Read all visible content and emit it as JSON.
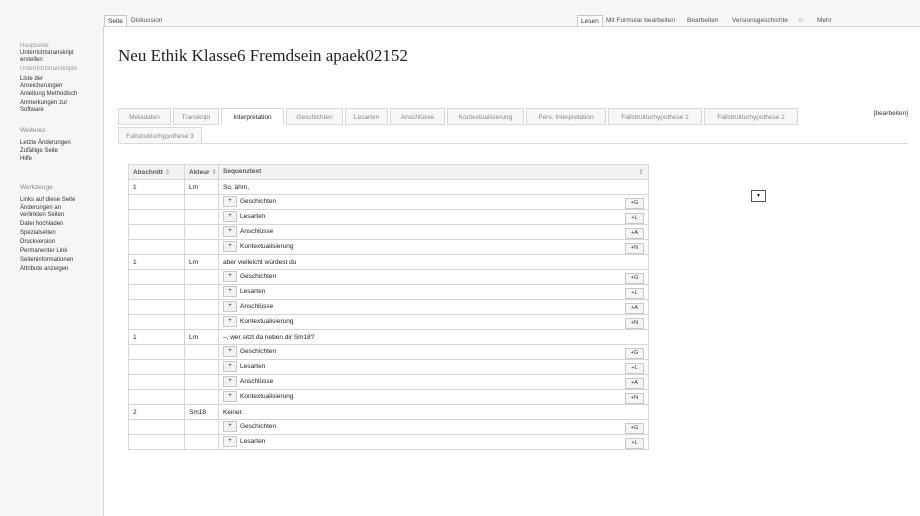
{
  "top_tabs": {
    "seite": "Seite",
    "diskussion": "Diskussion",
    "lesen": "Lesen",
    "mit_formular": "Mit Formular bearbeiten",
    "bearbeiten": "Bearbeiten",
    "versionsgeschichte": "Versionsgeschichte",
    "star_icon": "☆",
    "mehr": "Mehr"
  },
  "sidebar": {
    "nav": [
      {
        "label": "Hauptseite",
        "dim": true
      },
      {
        "label": "Unterrichtstranskript",
        "dim": false
      },
      {
        "label": "erstellen",
        "dim": false
      },
      {
        "label": "Unterrichtstranskripte",
        "dim": true
      },
      {
        "label": "Liste der",
        "dim": false
      },
      {
        "label": "Anreicherungen",
        "dim": false
      },
      {
        "label": "Anleitung Methodisch",
        "dim": false
      },
      {
        "label": "Anmerkungen zur",
        "dim": false
      },
      {
        "label": "Software",
        "dim": false
      }
    ],
    "weiteres_heading": "Weiteres",
    "weiteres": [
      "Letzte Änderungen",
      "Zufällige Seite",
      "Hilfe"
    ],
    "werkzeuge_heading": "Werkzeuge",
    "werkzeuge": [
      "Links auf diese Seite",
      "Änderungen an",
      "verlinkten Seiten",
      "Datei hochladen",
      "Spezialseiten",
      "Druckversion",
      "Permanenter Link",
      "Seiteninformationen",
      "Attribute anzeigen"
    ]
  },
  "page": {
    "title": "Neu Ethik Klasse6 Fremdsein apaek02152",
    "edit_link": "[bearbeiten]"
  },
  "content_tabs": {
    "row1": [
      "Metadaten",
      "Transkript",
      "Interpretation",
      "Geschichten",
      "Lesarten",
      "Anschlüsse",
      "Kontextualisierung",
      "Pers. Interpretation",
      "Fallstrukturhypothese 1",
      "Fallstrukturhypothese 2"
    ],
    "row2": [
      "Fallstrukturhypothese 3"
    ],
    "active": "Interpretation"
  },
  "table": {
    "headers": {
      "abschnitt": "Abschnitt",
      "akteur": "Akteur",
      "sequenztext": "Sequenztext",
      "sort_icon": "⇕"
    },
    "select_icon": "▾",
    "plus_label": "+",
    "sub_rows": [
      {
        "label": "Geschichten",
        "tag": "+G"
      },
      {
        "label": "Lesarten",
        "tag": "+L"
      },
      {
        "label": "Anschlüsse",
        "tag": "+A"
      },
      {
        "label": "Kontextualisierung",
        "tag": "+N"
      }
    ],
    "rows": [
      {
        "abschnitt": "1",
        "akteur": "Lm",
        "text": "So, ähm,"
      },
      {
        "abschnitt": "1",
        "akteur": "Lm",
        "text": "aber vielleicht würdest du"
      },
      {
        "abschnitt": "1",
        "akteur": "Lm",
        "text": "–, wer sitzt da neben dir Sm18?"
      },
      {
        "abschnitt": "2",
        "akteur": "Sm18",
        "text": "Keiner."
      }
    ]
  }
}
